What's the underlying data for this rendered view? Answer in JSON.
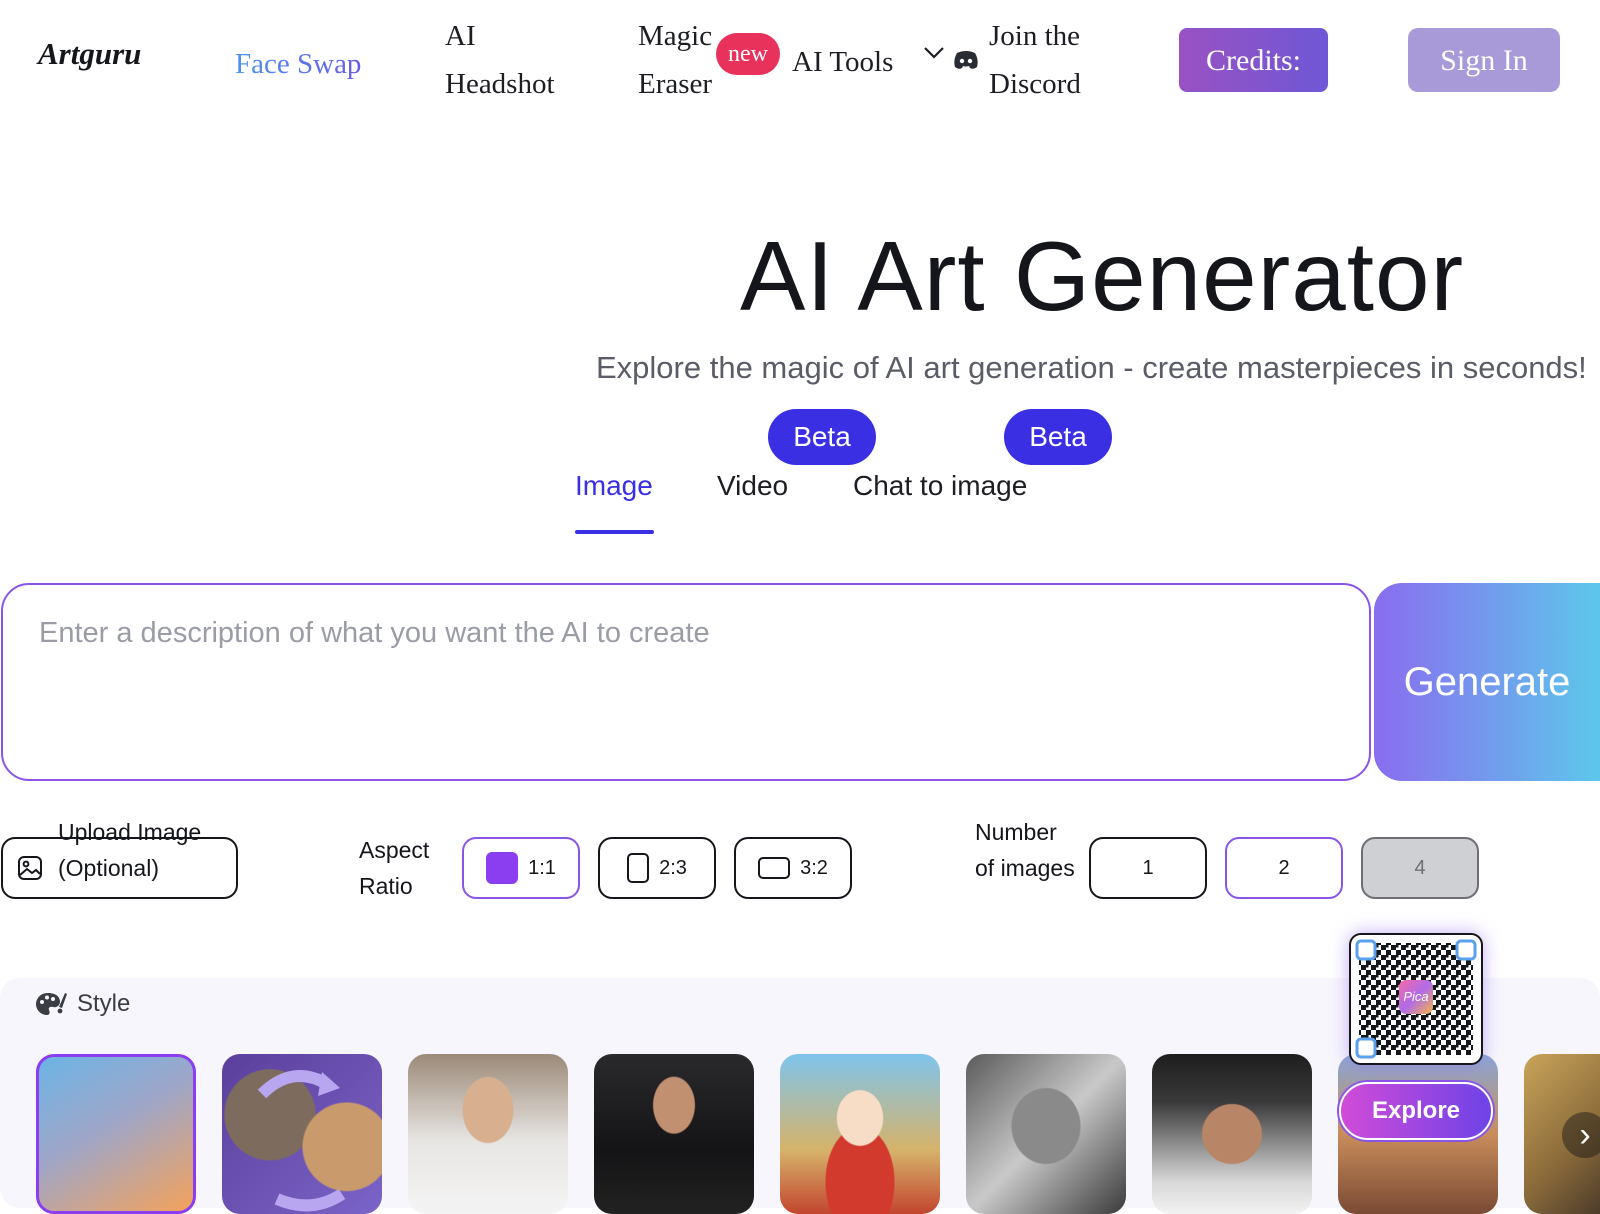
{
  "header": {
    "logo": "Artguru",
    "nav": {
      "face_swap": "Face Swap",
      "ai_headshot": [
        "AI",
        "Headshot"
      ],
      "magic_eraser": [
        "Magic",
        "Eraser"
      ],
      "magic_eraser_badge": "new",
      "ai_tools": "AI Tools",
      "join_discord": [
        "Join the",
        "Discord"
      ]
    },
    "credits_label": "Credits:",
    "sign_in": "Sign In"
  },
  "hero": {
    "title": "AI Art Generator",
    "subtitle": "Explore the magic of AI art generation - create masterpieces in seconds!"
  },
  "tabs": [
    {
      "label": "Image",
      "badge": "",
      "active": true
    },
    {
      "label": "Video",
      "badge": "Beta",
      "active": false
    },
    {
      "label": "Chat to image",
      "badge": "Beta",
      "active": false
    }
  ],
  "prompt": {
    "placeholder": "Enter a description of what you want the AI to create",
    "value": "",
    "generate_label": "Generate"
  },
  "controls": {
    "upload_label": "Upload Image (Optional)",
    "aspect_ratio_label": "Aspect Ratio",
    "aspect_ratios": [
      "1:1",
      "2:3",
      "3:2"
    ],
    "aspect_selected": "1:1",
    "number_label": "Number of images",
    "numbers": [
      "1",
      "2",
      "4"
    ],
    "number_selected": "2",
    "number_disabled": "4"
  },
  "style": {
    "label": "Style",
    "thumbnails": [
      "none-gradient",
      "face-swap-portraits",
      "woman-portrait",
      "man-suit",
      "anime-girl",
      "wolf-tattoo",
      "man-portrait",
      "fantasy-scene",
      "ornate-scene"
    ]
  },
  "promo": {
    "qr_logo": "Pica",
    "explore": "Explore"
  },
  "colors": {
    "accent": "#3a2fe3",
    "purple": "#8a55e6",
    "badge_red": "#e8325c"
  }
}
